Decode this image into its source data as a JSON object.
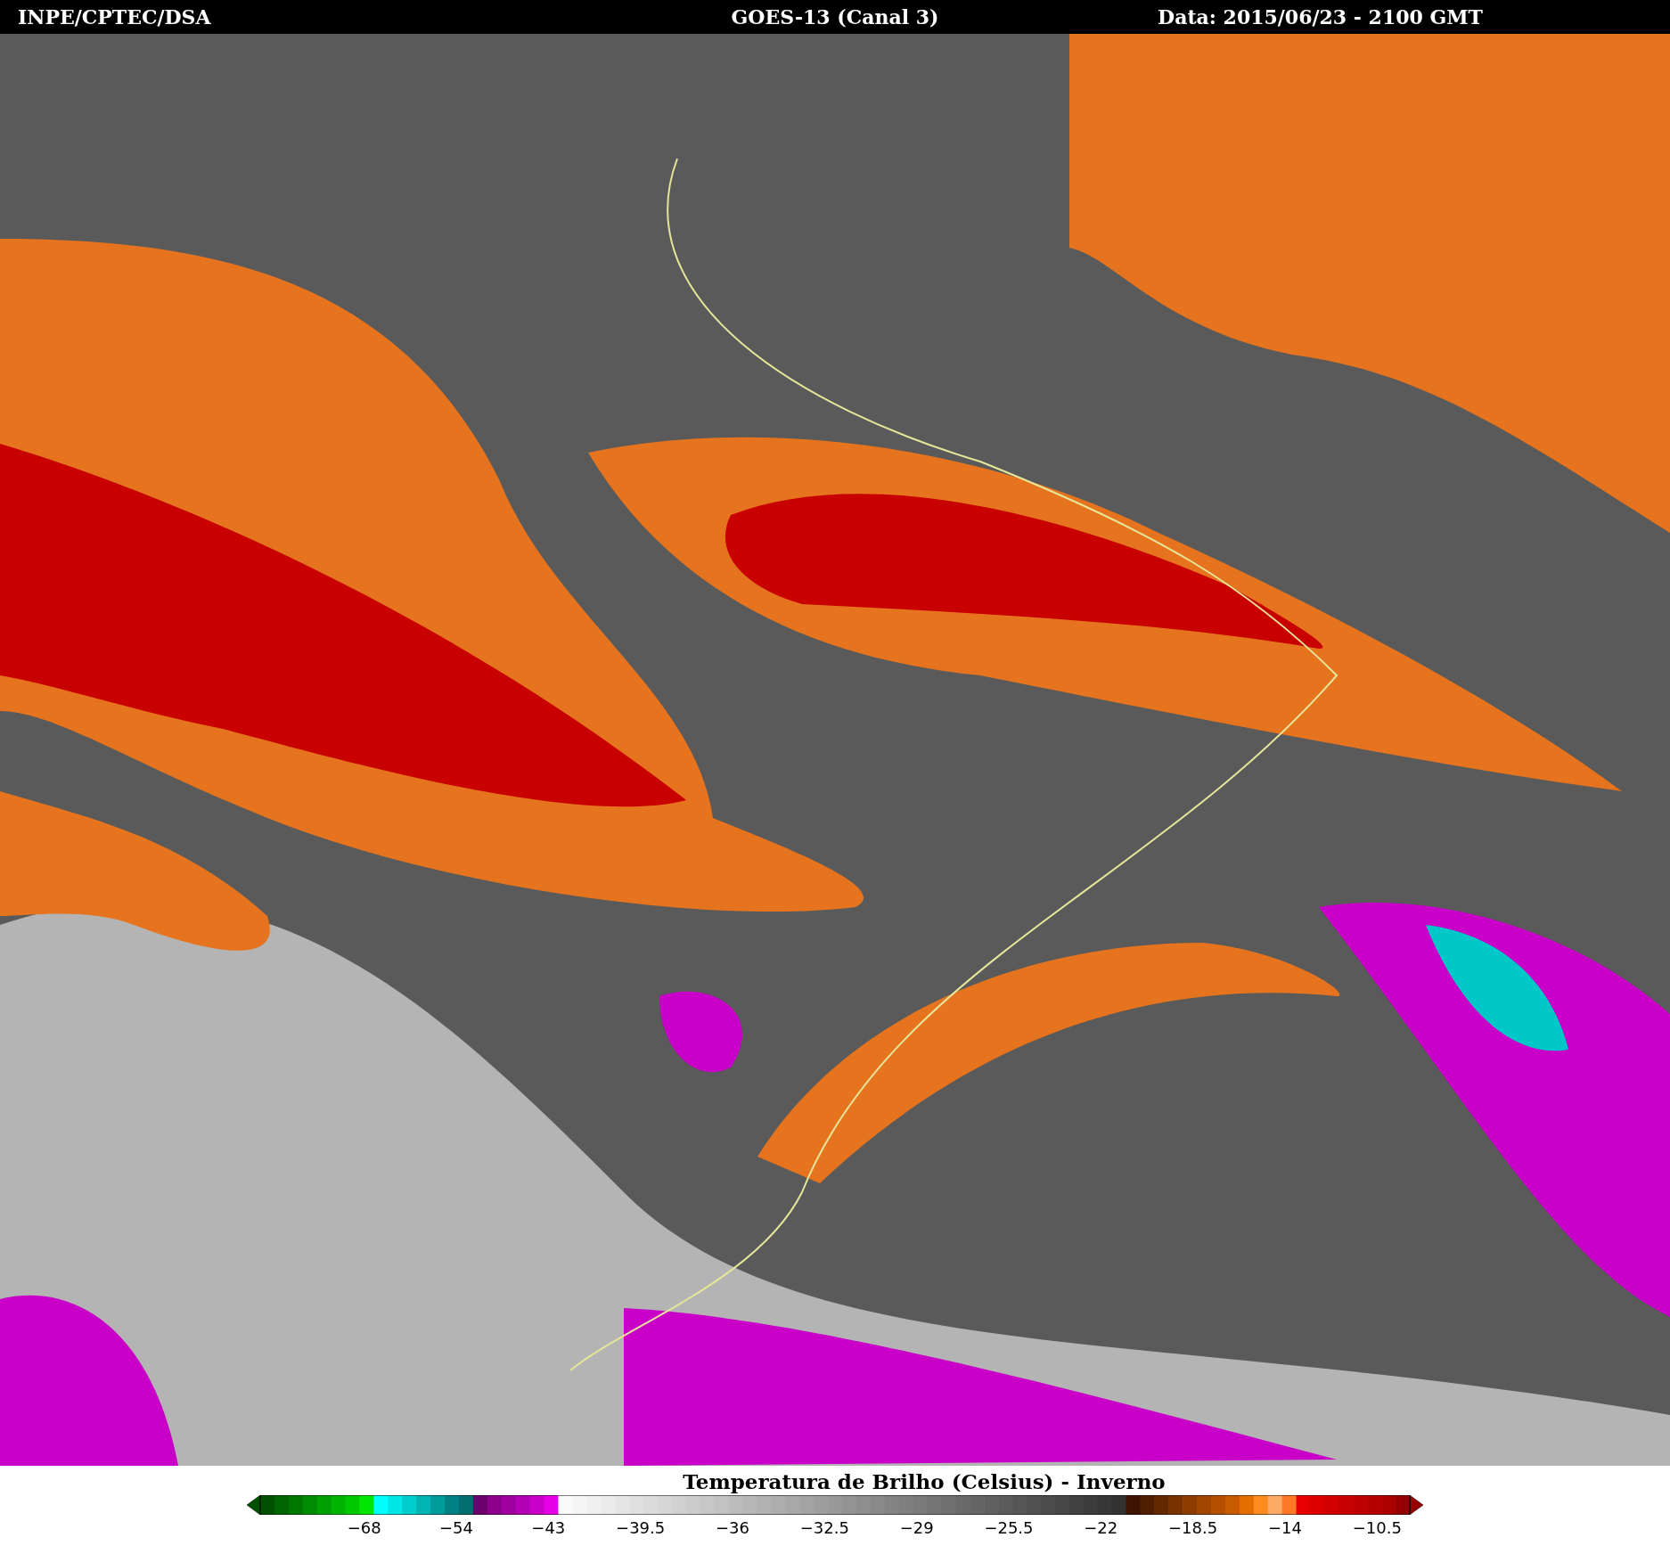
{
  "header": {
    "source": "INPE/CPTEC/DSA",
    "satellite": "GOES-13 (Canal 3)",
    "date": "Data: 2015/06/23 - 2100 GMT"
  },
  "legend": {
    "title": "Temperatura de Brilho (Celsius) - Inverno",
    "ticks": [
      "−68",
      "−54",
      "−43",
      "−39.5",
      "−36",
      "−32.5",
      "−29",
      "−25.5",
      "−22",
      "−18.5",
      "−14",
      "−10.5"
    ]
  }
}
